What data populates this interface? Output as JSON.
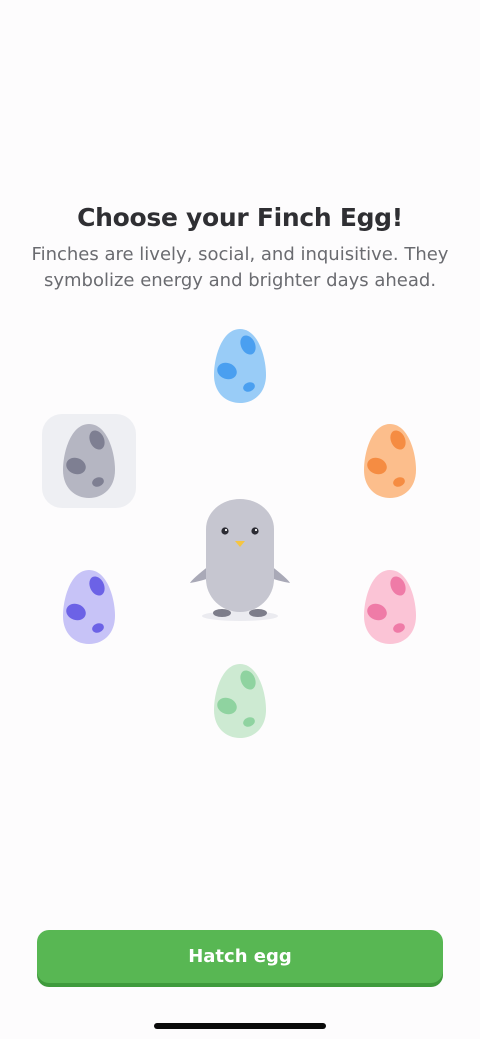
{
  "header": {
    "title": "Choose your Finch Egg!",
    "subtitle": "Finches are lively, social, and inquisitive. They symbolize energy and brighter days ahead."
  },
  "eggs": [
    {
      "name": "blue",
      "body": "#99ccf7",
      "spot": "#4a9ff0",
      "selected": false
    },
    {
      "name": "gray",
      "body": "#b5b6c2",
      "spot": "#7e7f92",
      "selected": true
    },
    {
      "name": "orange",
      "body": "#fcbe8c",
      "spot": "#f58c42",
      "selected": false
    },
    {
      "name": "purple",
      "body": "#c7c3f7",
      "spot": "#6c62e6",
      "selected": false
    },
    {
      "name": "pink",
      "body": "#fbc4d6",
      "spot": "#ef7ba7",
      "selected": false
    },
    {
      "name": "green",
      "body": "#cdead2",
      "spot": "#8fd3a0",
      "selected": false
    }
  ],
  "finch": {
    "icon": "finch-chick-icon",
    "body": "#c6c6d0",
    "beak": "#f5c542"
  },
  "actions": {
    "hatch_label": "Hatch egg"
  },
  "colors": {
    "accent": "#58b753",
    "background": "#fdfcfd"
  }
}
